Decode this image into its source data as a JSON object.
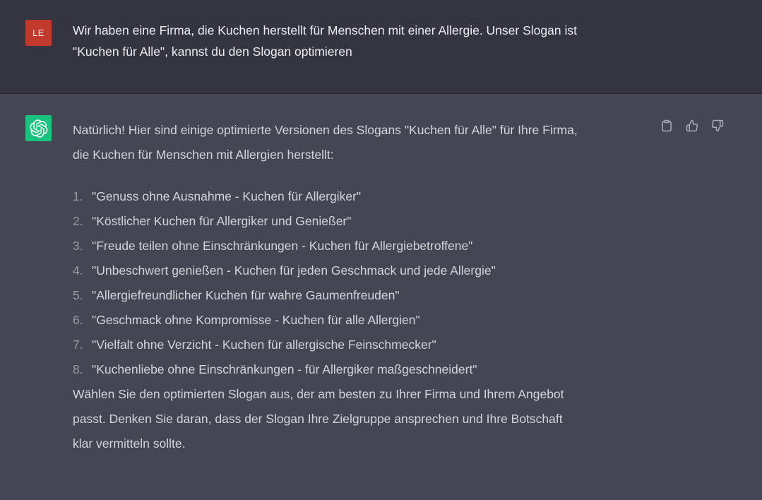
{
  "user_message": {
    "avatar_initials": "LE",
    "avatar_color": "#c0392b",
    "line1": "Wir haben eine Firma, die Kuchen herstellt für Menschen mit einer Allergie. Unser Slogan ist",
    "line2": "\"Kuchen für Alle\", kannst du den Slogan optimieren"
  },
  "assistant_message": {
    "avatar_icon": "openai-logo-icon",
    "avatar_color": "#19c37d",
    "intro_line1": "Natürlich! Hier sind einige optimierte Versionen des Slogans \"Kuchen für Alle\" für Ihre Firma,",
    "intro_line2": "die Kuchen für Menschen mit Allergien herstellt:",
    "items": [
      {
        "num": "1.",
        "text": "\"Genuss ohne Ausnahme - Kuchen für Allergiker\""
      },
      {
        "num": "2.",
        "text": "\"Köstlicher Kuchen für Allergiker und Genießer\""
      },
      {
        "num": "3.",
        "text": "\"Freude teilen ohne Einschränkungen - Kuchen für Allergiebetroffene\""
      },
      {
        "num": "4.",
        "text": "\"Unbeschwert genießen - Kuchen für jeden Geschmack und jede Allergie\""
      },
      {
        "num": "5.",
        "text": "\"Allergiefreundlicher Kuchen für wahre Gaumenfreuden\""
      },
      {
        "num": "6.",
        "text": "\"Geschmack ohne Kompromisse - Kuchen für alle Allergien\""
      },
      {
        "num": "7.",
        "text": "\"Vielfalt ohne Verzicht - Kuchen für allergische Feinschmecker\""
      },
      {
        "num": "8.",
        "text": "\"Kuchenliebe ohne Einschränkungen - für Allergiker maßgeschneidert\""
      }
    ],
    "outro_line1": "Wählen Sie den optimierten Slogan aus, der am besten zu Ihrer Firma und Ihrem Angebot",
    "outro_line2": "passt. Denken Sie daran, dass der Slogan Ihre Zielgruppe ansprechen und Ihre Botschaft",
    "outro_line3": "klar vermitteln sollte."
  },
  "actions": {
    "icons": [
      "clipboard-icon",
      "thumbs-up-icon",
      "thumbs-down-icon"
    ]
  },
  "colors": {
    "user_bg": "#343541",
    "assistant_bg": "#444654"
  }
}
